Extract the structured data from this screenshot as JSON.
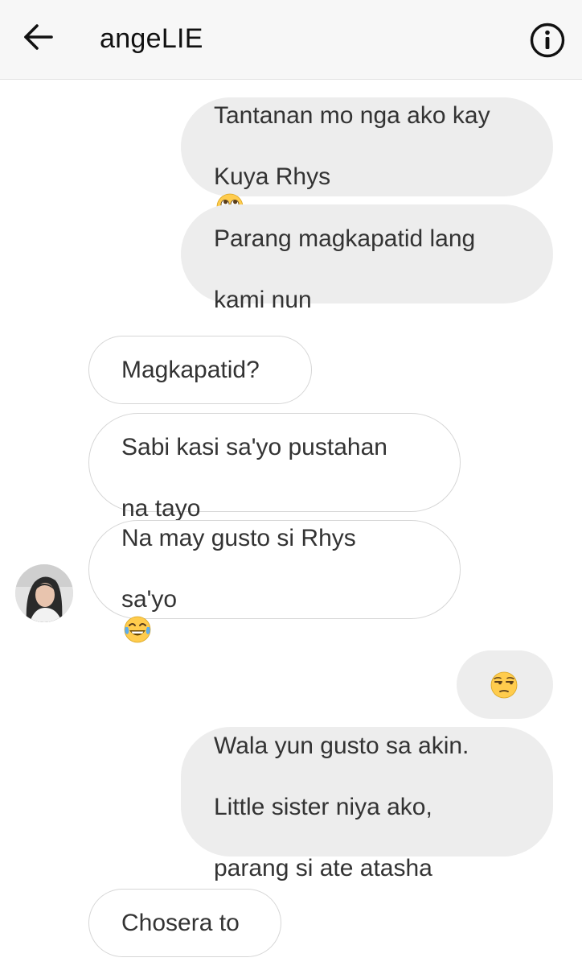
{
  "header": {
    "title": "angeLIE",
    "back_icon": "arrow-left-icon",
    "info_icon": "info-circle-icon"
  },
  "messages": [
    {
      "direction": "sent",
      "lines": [
        "Tantanan mo nga ako kay",
        "Kuya Rhys"
      ],
      "emoji": "face-with-rolling-eyes"
    },
    {
      "direction": "sent",
      "lines": [
        "Parang magkapatid lang",
        "kami nun"
      ]
    },
    {
      "direction": "received",
      "lines": [
        "Magkapatid?"
      ]
    },
    {
      "direction": "received",
      "lines": [
        "Sabi kasi sa'yo pustahan",
        "na tayo"
      ]
    },
    {
      "direction": "received",
      "lines": [
        "Na may gusto si Rhys",
        "sa'yo"
      ],
      "emoji": "face-with-tears-of-joy"
    },
    {
      "direction": "sent",
      "lines": [],
      "emoji": "unamused-face"
    },
    {
      "direction": "sent",
      "lines": [
        "Wala yun gusto sa akin.",
        "Little sister niya ako,",
        "parang si ate atasha"
      ]
    },
    {
      "direction": "received",
      "lines": [
        "Chosera to"
      ]
    }
  ],
  "colors": {
    "header_bg": "#f7f7f7",
    "sent_bubble": "#ededed",
    "received_bubble": "#ffffff",
    "received_border": "#d6d6d6",
    "text": "#333333"
  }
}
